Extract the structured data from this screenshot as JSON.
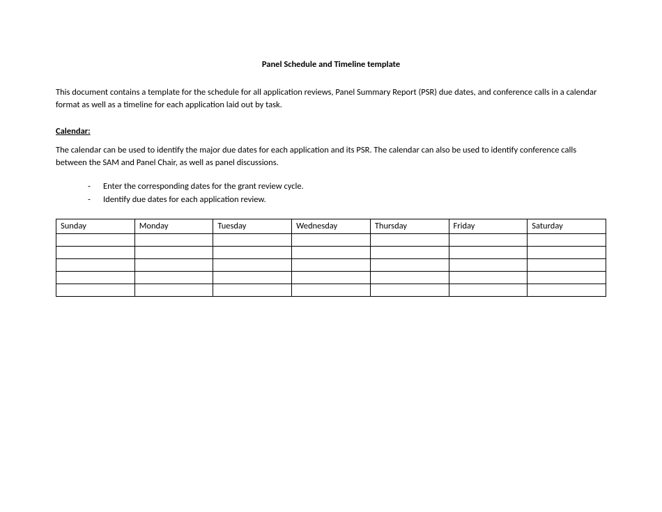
{
  "title": "Panel Schedule and Timeline template",
  "intro": "This document contains a template for the schedule for all application reviews, Panel Summary Report (PSR) due dates, and conference calls in a calendar format as well as a timeline for each application laid out by task.",
  "calendar": {
    "heading": "Calendar:",
    "description": "The calendar can be used to identify the major due dates for each application and its PSR.  The calendar can also be used to identify conference calls between the SAM and Panel Chair, as well as panel discussions.",
    "bullets": [
      "Enter the corresponding dates for the grant review cycle.",
      "Identify due dates for each application review."
    ],
    "headers": [
      "Sunday",
      "Monday",
      "Tuesday",
      "Wednesday",
      "Thursday",
      "Friday",
      "Saturday"
    ],
    "rows": [
      [
        "",
        "",
        "",
        "",
        "",
        "",
        ""
      ],
      [
        "",
        "",
        "",
        "",
        "",
        "",
        ""
      ],
      [
        "",
        "",
        "",
        "",
        "",
        "",
        ""
      ],
      [
        "",
        "",
        "",
        "",
        "",
        "",
        ""
      ],
      [
        "",
        "",
        "",
        "",
        "",
        "",
        ""
      ]
    ]
  }
}
